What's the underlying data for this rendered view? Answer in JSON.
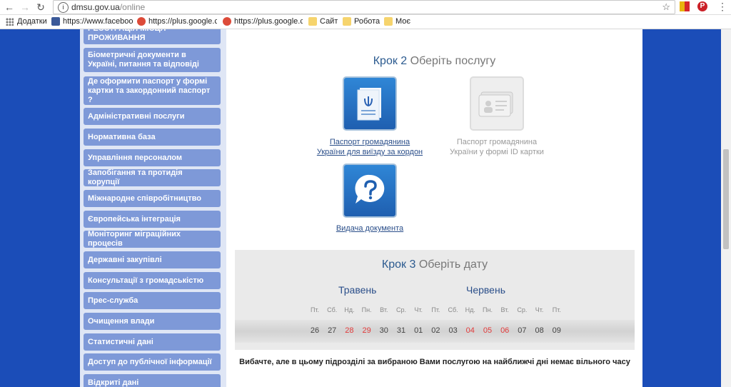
{
  "browser": {
    "url_host": "dmsu.gov.ua",
    "url_path": "/online",
    "bookmarks": [
      {
        "label": "Додатки",
        "type": "apps"
      },
      {
        "label": "https://www.faceboo",
        "type": "facebook"
      },
      {
        "label": "https://plus.google.co",
        "type": "gplus"
      },
      {
        "label": "https://plus.google.co",
        "type": "gplus"
      },
      {
        "label": "Сайт",
        "type": "folder"
      },
      {
        "label": "Робота",
        "type": "folder"
      },
      {
        "label": "Моє",
        "type": "folder"
      }
    ]
  },
  "sidebar": {
    "items": [
      "РЕЄСТРАЦІЯ МІСЦЯ ПРОЖИВАННЯ",
      "Біометричні документи в Україні, питання та відповіді",
      "Де оформити паспорт у формі картки та закордонний паспорт ?",
      "Адміністративні послуги",
      "Нормативна база",
      "Управління персоналом",
      "Запобігання та протидія корупції",
      "Міжнародне співробітництво",
      "Європейська інтеграція",
      "Моніторинг міграційних процесів",
      "Державні закупівлі",
      "Консультації з громадськістю",
      "Прес-служба",
      "Очищення влади",
      "Статистичні дані",
      "Доступ до публічної інформації",
      "Відкриті дані"
    ]
  },
  "step2": {
    "step_label": "Крок 2",
    "title": "Оберіть послугу",
    "services": [
      {
        "label_line1": "Паспорт громадянина",
        "label_line2": "України для виїзду за кордон",
        "icon": "passport-icon",
        "enabled": true
      },
      {
        "label_line1": "Паспорт громадянина",
        "label_line2": "України у формі ID картки",
        "icon": "id-card-icon",
        "enabled": false
      },
      {
        "label_line1": "Видача документа",
        "label_line2": "",
        "icon": "question-bubble-icon",
        "enabled": true
      }
    ]
  },
  "step3": {
    "step_label": "Крок 3",
    "title": "Оберіть дату",
    "months": [
      "Травень",
      "Червень"
    ],
    "weekdays": [
      "Пт.",
      "Сб.",
      "Нд.",
      "Пн.",
      "Вт.",
      "Ср.",
      "Чт.",
      "Пт.",
      "Сб.",
      "Нд.",
      "Пн.",
      "Вт.",
      "Ср.",
      "Чт.",
      "Пт."
    ],
    "dates": [
      "26",
      "27",
      "28",
      "29",
      "30",
      "31",
      "01",
      "02",
      "03",
      "04",
      "05",
      "06",
      "07",
      "08",
      "09"
    ],
    "red_dates_index": [
      2,
      3,
      9,
      10,
      11
    ],
    "message": "Вибачте, але в цьому підрозділі за вибраною Вами послугою на найближчі дні немає вільного часу"
  },
  "colors": {
    "page_background": "#1b4db8",
    "menu_item": "#7e99d8",
    "accent_text": "#2b4f8a",
    "weekend_red": "#e23b3b"
  }
}
